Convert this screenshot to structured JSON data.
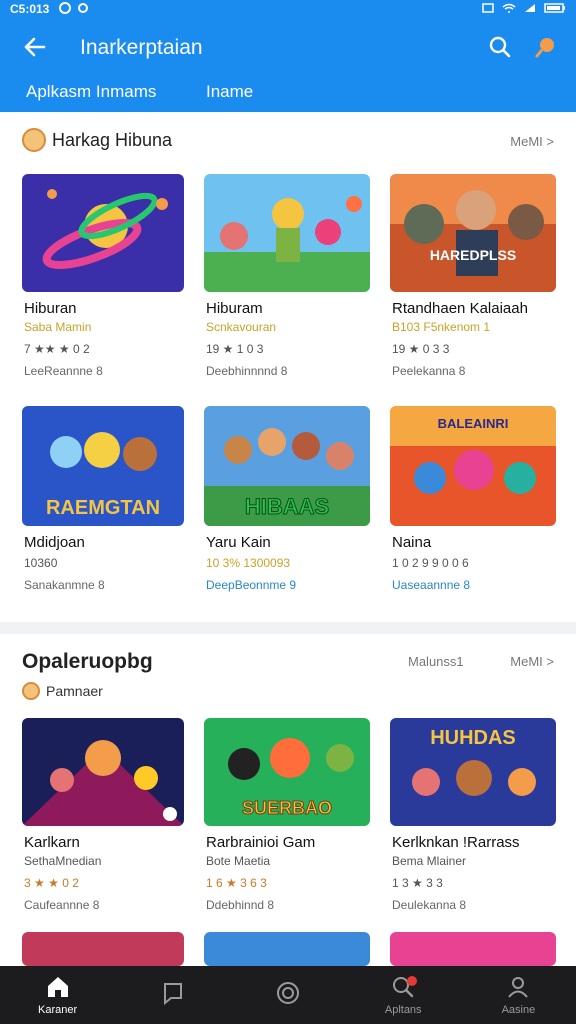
{
  "status": {
    "time": "C5:013"
  },
  "app_bar": {
    "title": "Inarkerptaian",
    "tabs": [
      "Aplkasm Inmams",
      "Iname"
    ]
  },
  "section1": {
    "title": "Harkag Hibuna",
    "more": "MeMI >",
    "cards": [
      {
        "name": "Hiburan",
        "sub": "Saba Mamin",
        "rating": "7 ★★ ★ 0 2",
        "meta": "LeeReannne 8"
      },
      {
        "name": "Hiburam",
        "sub": "Scnkavouran",
        "rating": "19 ★ 1 0 3",
        "meta": "Deebhinnnnd 8"
      },
      {
        "name": "Rtandhaen Kalaiaah",
        "sub": "B103 F5nkenom 1",
        "rating": "19 ★ 0 3 3",
        "meta": "Peelekanna 8"
      },
      {
        "name": "Mdidjoan",
        "sub": "10360",
        "rating": "",
        "meta": "Sanakanmne 8"
      },
      {
        "name": "Yaru Kain",
        "sub": "10 3% 1300093",
        "rating": "",
        "meta": "DeepBeonnme 9"
      },
      {
        "name": "Naina",
        "sub": "1 0 2 9 9 0 0 6",
        "rating": "",
        "meta": "Uaseaannne 8"
      }
    ],
    "thumb_texts": [
      "",
      "",
      "HAREDPLSS",
      "RAEMGTAN",
      "HIBAAS",
      "BALEAINRI"
    ]
  },
  "section2": {
    "title": "Opaleruopbg",
    "sort": "Malunss1",
    "more": "MeMI >",
    "subtitle": "Pamnaer",
    "cards": [
      {
        "name": "Karlkarn",
        "sub": "SethaMnedian",
        "rating": "3 ★ ★ 0 2",
        "meta": "Caufeannne 8"
      },
      {
        "name": "Rarbrainioi Gam",
        "sub": "Bote Maetia",
        "rating": "1 6 ★ 3 6 3",
        "meta": "Ddebhinnd 8"
      },
      {
        "name": "Kerlknkan !Rarrass",
        "sub": "Bema Mlainer",
        "rating": "1 3 ★ 3 3",
        "meta": "Deulekanna 8"
      }
    ],
    "thumb_texts": [
      "",
      "SUERBAO",
      "HUHDAS"
    ]
  },
  "nav": {
    "items": [
      {
        "label": "Karaner",
        "icon": "home-icon"
      },
      {
        "label": "",
        "icon": "chat-icon"
      },
      {
        "label": "",
        "icon": "circle-icon"
      },
      {
        "label": "Apltans",
        "icon": "search-icon"
      },
      {
        "label": "Aasine",
        "icon": "profile-icon"
      }
    ]
  },
  "colors": {
    "primary": "#1a8cf0",
    "nav_bg": "#1c1c1e",
    "accent_orange": "#f39c4a",
    "rating_gold": "#c9a227"
  }
}
